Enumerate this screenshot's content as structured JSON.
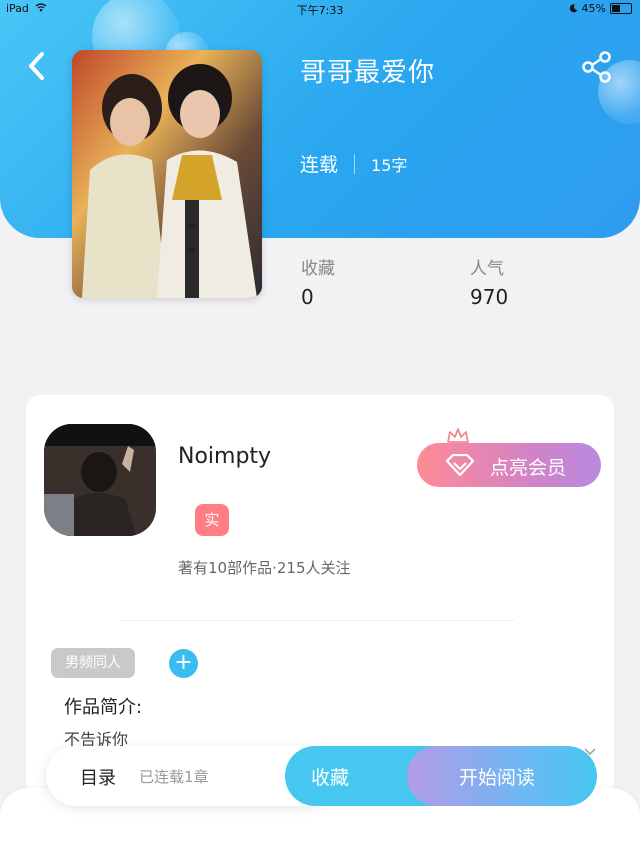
{
  "status_bar": {
    "device": "iPad",
    "time": "下午7:33",
    "battery": "45%",
    "battery_level": 0.45
  },
  "book": {
    "title": "哥哥最爱你",
    "status": "连载",
    "word_count": "15字",
    "cover_icon": "cover-image"
  },
  "stats": [
    {
      "label": "收藏",
      "value": "0"
    },
    {
      "label": "人气",
      "value": "970"
    }
  ],
  "author": {
    "name": "Noimpty",
    "badge": "实",
    "meta": "著有10部作品·215人关注",
    "vip_button": "点亮会员"
  },
  "tags": [
    "男频同人"
  ],
  "intro": {
    "heading": "作品简介:",
    "text": "不告诉你"
  },
  "bottom_bar": {
    "toc_label": "目录",
    "toc_sub": "已连载1章",
    "favorite_label": "收藏",
    "read_label": "开始阅读"
  },
  "colors": {
    "accent_blue": "#29a6ef",
    "badge_pink": "#ff7d84",
    "tag_gray": "#c9c9cc"
  },
  "icons": [
    "back-icon",
    "share-icon",
    "wifi-icon",
    "moon-icon",
    "crown-icon",
    "diamond-icon",
    "plus-icon",
    "chevron-down-icon"
  ]
}
